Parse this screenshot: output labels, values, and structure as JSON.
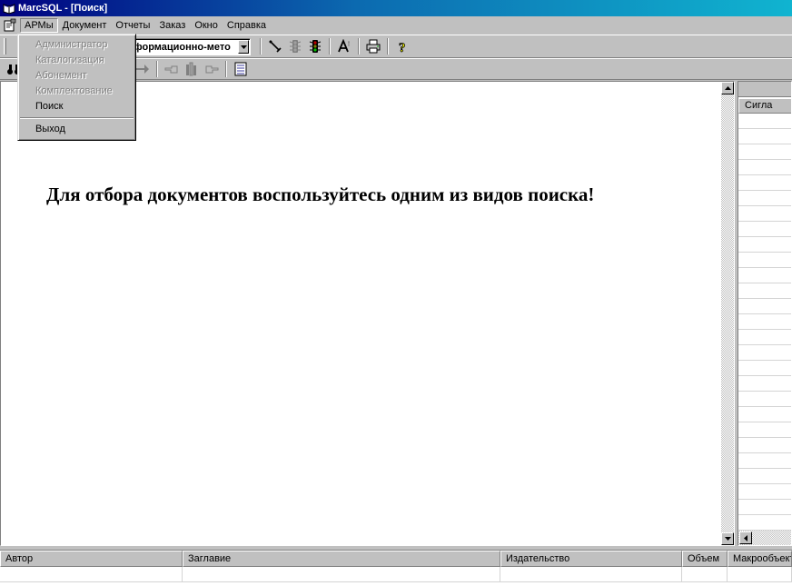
{
  "window": {
    "title": "MarcSQL - [Поиск]"
  },
  "menubar": {
    "items": [
      {
        "label": "АРМы",
        "active": true
      },
      {
        "label": "Документ"
      },
      {
        "label": "Отчеты"
      },
      {
        "label": "Заказ"
      },
      {
        "label": "Окно"
      },
      {
        "label": "Справка"
      }
    ]
  },
  "arm_menu": {
    "items": [
      {
        "label": "Администратор",
        "enabled": false
      },
      {
        "label": "Каталогизация",
        "enabled": false
      },
      {
        "label": "Абонемент",
        "enabled": false
      },
      {
        "label": "Комплектование",
        "enabled": false
      },
      {
        "label": "Поиск",
        "enabled": true
      },
      {
        "label": "Выход",
        "enabled": true
      }
    ]
  },
  "toolbar": {
    "database_combo_value": "формационно-мето",
    "icons": [
      "pointer-icon",
      "traffic-light-gray-icon",
      "traffic-light-green-icon",
      "font-icon",
      "print-icon",
      "help-icon"
    ]
  },
  "toolbar2": {
    "icons": [
      "binoculars-icon",
      "arrow-right-icon",
      "hand-point-left-icon",
      "books-icon",
      "hand-point-right-icon",
      "grid-icon"
    ]
  },
  "main": {
    "message": "Для отбора документов воспользуйтесь одним из видов поиска!"
  },
  "right_panel": {
    "column_header": "Сигла"
  },
  "results_table": {
    "columns": [
      {
        "label": "Автор"
      },
      {
        "label": "Заглавие"
      },
      {
        "label": "Издательство"
      },
      {
        "label": "Объем"
      },
      {
        "label": "Макрообъект"
      }
    ]
  },
  "colors": {
    "titlebar_start": "#000080",
    "titlebar_end": "#10b4d0",
    "face": "#c0c0c0",
    "disabled_text": "#808080"
  }
}
